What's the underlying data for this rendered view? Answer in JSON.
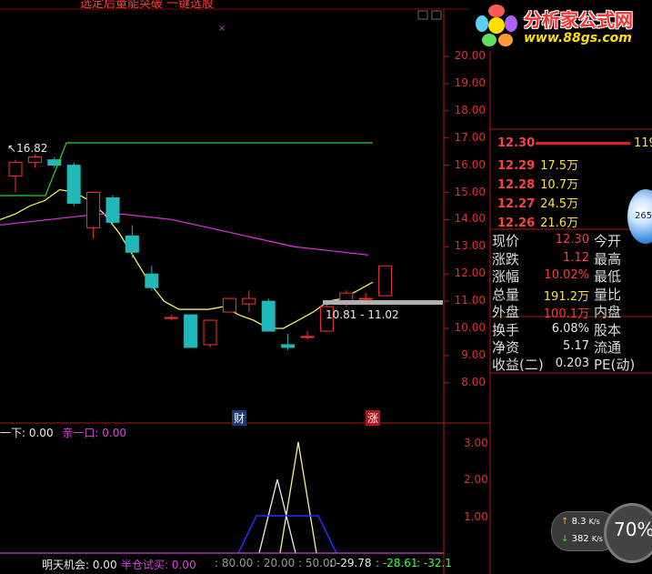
{
  "top_banner": "选定后量能突破 一键选股",
  "logo": {
    "title": "分析家公式网",
    "url": "www.88gs.com"
  },
  "chart_data": {
    "type": "candlestick",
    "price_axis": {
      "ticks": [
        "20.00",
        "19.00",
        "18.00",
        "17.00",
        "16.00",
        "15.00",
        "14.00",
        "13.00",
        "12.00",
        "11.00",
        "10.00",
        "9.00",
        "8.00"
      ],
      "range": [
        7.5,
        20.4
      ]
    },
    "candles": [
      {
        "o": 15.6,
        "h": 16.2,
        "l": 15.0,
        "c": 16.1
      },
      {
        "o": 16.1,
        "h": 16.4,
        "l": 15.9,
        "c": 16.3
      },
      {
        "o": 16.2,
        "h": 16.3,
        "l": 15.9,
        "c": 16.0
      },
      {
        "o": 16.0,
        "h": 16.1,
        "l": 14.5,
        "c": 14.6
      },
      {
        "o": 13.7,
        "h": 15.0,
        "l": 13.3,
        "c": 15.0
      },
      {
        "o": 14.8,
        "h": 14.9,
        "l": 13.8,
        "c": 13.9
      },
      {
        "o": 13.4,
        "h": 13.8,
        "l": 12.6,
        "c": 12.8
      },
      {
        "o": 12.0,
        "h": 12.3,
        "l": 11.4,
        "c": 11.5
      },
      {
        "o": 10.4,
        "h": 10.5,
        "l": 10.3,
        "c": 10.4
      },
      {
        "o": 10.5,
        "h": 10.5,
        "l": 9.3,
        "c": 9.3
      },
      {
        "o": 9.4,
        "h": 10.3,
        "l": 9.3,
        "c": 10.3
      },
      {
        "o": 10.6,
        "h": 11.1,
        "l": 10.6,
        "c": 11.1
      },
      {
        "o": 10.9,
        "h": 11.4,
        "l": 10.6,
        "c": 11.1
      },
      {
        "o": 11.0,
        "h": 11.1,
        "l": 9.9,
        "c": 9.9
      },
      {
        "o": 9.4,
        "h": 9.8,
        "l": 9.2,
        "c": 9.3
      },
      {
        "o": 9.7,
        "h": 9.9,
        "l": 9.6,
        "c": 9.7
      },
      {
        "o": 9.9,
        "h": 10.9,
        "l": 9.9,
        "c": 10.8
      },
      {
        "o": 11.0,
        "h": 11.4,
        "l": 10.8,
        "c": 11.3
      },
      {
        "o": 11.1,
        "h": 11.3,
        "l": 10.9,
        "c": 11.1
      },
      {
        "o": 11.2,
        "h": 12.3,
        "l": 11.2,
        "c": 12.3
      }
    ],
    "ma_yellow": [
      14.0,
      14.2,
      14.5,
      14.7,
      15.1,
      15.0,
      14.7,
      14.2,
      13.5,
      12.6,
      11.7,
      11.0,
      10.7,
      10.7,
      10.7,
      10.8,
      10.5,
      10.3,
      10.0,
      10.0,
      10.3,
      10.6,
      11.0,
      11.1,
      11.4,
      11.7
    ],
    "ma_magenta": [
      13.8,
      13.9,
      14.0,
      14.1,
      14.2,
      14.2,
      14.1,
      14.0,
      13.8,
      13.6,
      13.4,
      13.2,
      13.0,
      12.9,
      12.8,
      12.7
    ],
    "high_label": "16.82",
    "range_label": "10.81 - 11.02",
    "event_labels": [
      "财",
      "涨"
    ],
    "indicator": {
      "legend": [
        {
          "label": "一下: 0.00",
          "color": "#e8e8e8"
        },
        {
          "label": "亲一口: 0.00",
          "color": "#e040e0"
        }
      ],
      "ticks": [
        "3.00",
        "2.00",
        "1.00"
      ],
      "range": [
        0,
        3.3
      ]
    }
  },
  "order_book": [
    {
      "price": "12.30",
      "vol": "119"
    },
    {
      "price": "12.29",
      "vol": "17.5万"
    },
    {
      "price": "12.28",
      "vol": "10.7万"
    },
    {
      "price": "12.27",
      "vol": "24.5万"
    },
    {
      "price": "12.26",
      "vol": "21.6万"
    }
  ],
  "quote_rows": [
    {
      "label": "现价",
      "value": "12.30",
      "value_color": "red",
      "label2": "今开"
    },
    {
      "label": "涨跌",
      "value": "1.12",
      "value_color": "red",
      "label2": "最高"
    },
    {
      "label": "涨幅",
      "value": "10.02%",
      "value_color": "red",
      "label2": "最低"
    },
    {
      "label": "总量",
      "value": "191.2万",
      "value_color": "yellow",
      "label2": "量比"
    },
    {
      "label": "外盘",
      "value": "100.1万",
      "value_color": "red",
      "label2": "内盘"
    },
    {
      "label": "换手",
      "value": "6.08%",
      "value_color": "white",
      "label2": "股本"
    },
    {
      "label": "净资",
      "value": "5.17",
      "value_color": "white",
      "label2": "流通"
    },
    {
      "label": "收益(二)",
      "value": "0.203",
      "value_color": "white",
      "label2": "PE(动)"
    }
  ],
  "bottom_bar": {
    "tomorrow_chance": "明天机会: 0.00",
    "position_test": "半仓试买: 0.00",
    "levels": ": 80.00 : 20.00 : 50.00",
    "val1": ": -29.78",
    "val2": ": -28.61",
    "val3": ": -32.1"
  },
  "network": {
    "upload": "8.3",
    "download": "382",
    "unit": "K/s",
    "gauge": "70%"
  },
  "orb_text": "265"
}
